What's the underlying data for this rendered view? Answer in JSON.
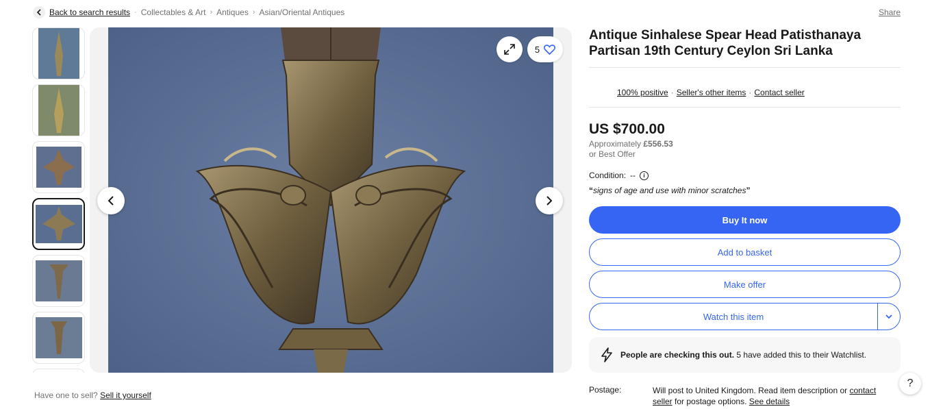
{
  "breadcrumb": {
    "back_label": "Back to search results",
    "items": [
      "Collectables & Art",
      "Antiques",
      "Asian/Oriental Antiques"
    ],
    "share_label": "Share"
  },
  "gallery": {
    "watch_count": "5",
    "thumb_count": 7
  },
  "sell": {
    "prompt": "Have one to sell?",
    "link": "Sell it yourself"
  },
  "item": {
    "title": "Antique Sinhalese Spear Head Patisthanaya Partisan 19th Century Ceylon Sri Lanka",
    "seller_feedback": "100% positive",
    "seller_other_items": "Seller's other items",
    "contact_seller": "Contact seller",
    "price": "US $700.00",
    "approx_prefix": "Approximately",
    "approx_value": "£556.53",
    "best_offer": "or Best Offer",
    "condition_label": "Condition:",
    "condition_value": "--",
    "condition_quote": "signs of age and use with minor scratches"
  },
  "actions": {
    "buy_now": "Buy It now",
    "add_to_basket": "Add to basket",
    "make_offer": "Make offer",
    "watch": "Watch this item"
  },
  "checking": {
    "bold": "People are checking this out.",
    "rest": "5 have added this to their Watchlist."
  },
  "postage": {
    "label": "Postage:",
    "text1": "Will post to United Kingdom. Read item description or",
    "contact_link1": "contact",
    "contact_link2": "seller",
    "text2": "for postage options.",
    "details_link": "See details"
  },
  "colors": {
    "accent": "#3665f3",
    "photo_bg": "#5f7295",
    "brass": "#8a7a55"
  }
}
